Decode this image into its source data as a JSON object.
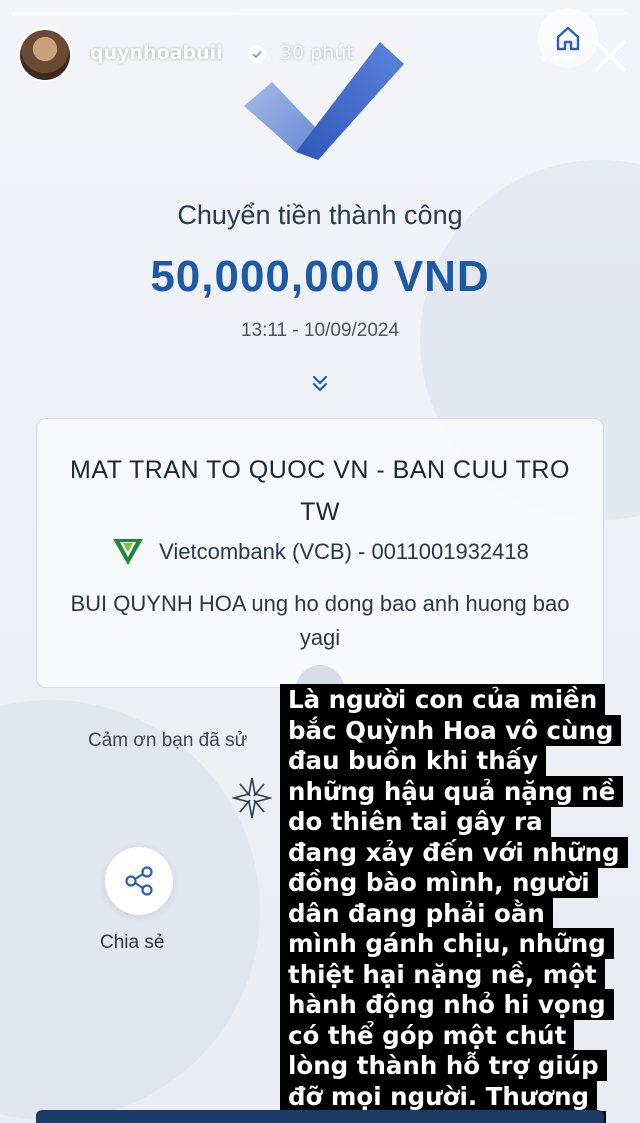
{
  "story": {
    "username": "quynhoabuii",
    "time_ago": "30 phút",
    "progress": 0.37
  },
  "receipt": {
    "title": "Chuyển tiền thành công",
    "amount": "50,000,000 VND",
    "datetime": "13:11 - 10/09/2024",
    "recipient_name": "MAT TRAN TO QUOC VN - BAN CUU TRO TW",
    "bank": "Vietcombank (VCB) - 0011001932418",
    "message": "BUI QUYNH HOA ung ho dong bao anh huong bao yagi",
    "thanks_partial": "Cảm ơn bạn đã sử",
    "share_label": "Chia sẻ"
  },
  "caption": "Là người con của miền bắc Quỳnh Hoa vô cùng đau buồn khi thấy những hậu quả nặng nề do thiên tai gây ra đang xảy đến với những đồng bào mình, người dân đang phải oằn mình gánh chịu, những thiệt hại nặng nề, một hành động nhỏ hi vọng có thể góp một chút lòng thành hỗ trợ giúp đỡ mọi người. Thương lắm miền Bắc ruột thịt ơi",
  "icons": {
    "verified": "verified-badge-icon",
    "home": "home-icon",
    "more": "more-icon",
    "close": "close-icon",
    "check": "checkmark-icon",
    "expand": "chevron-double-down-icon",
    "bank": "vietcombank-logo-icon",
    "sparkle": "sparkle-icon",
    "share": "share-icon"
  },
  "colors": {
    "amount": "#1d5aa6",
    "caption_bg": "#000000",
    "caption_text": "#ffffff",
    "bank_green": "#1b8a3c"
  }
}
